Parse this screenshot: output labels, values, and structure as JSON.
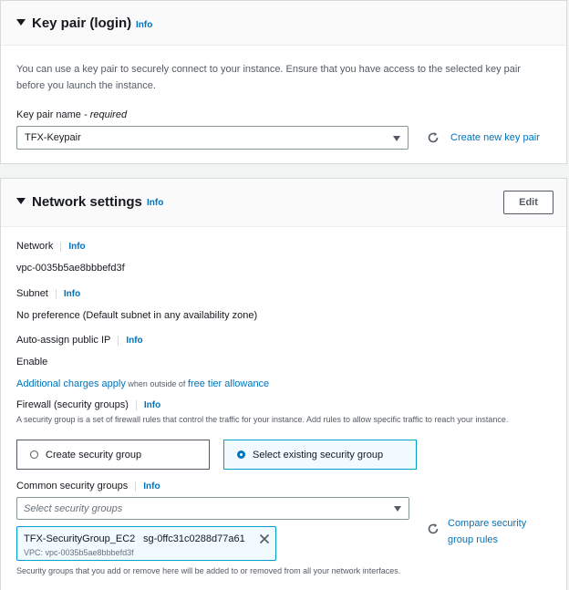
{
  "keypair": {
    "title": "Key pair (login)",
    "info": "Info",
    "description": "You can use a key pair to securely connect to your instance. Ensure that you have access to the selected key pair before you launch the instance.",
    "field_label": "Key pair name",
    "field_required": " - required",
    "selected_value": "TFX-Keypair",
    "create_link": "Create new key pair"
  },
  "network": {
    "title": "Network settings",
    "info": "Info",
    "edit_label": "Edit",
    "network_label": "Network",
    "network_value": "vpc-0035b5ae8bbbefd3f",
    "subnet_label": "Subnet",
    "subnet_value": "No preference (Default subnet in any availability zone)",
    "auto_ip_label": "Auto-assign public IP",
    "auto_ip_value": "Enable",
    "charges_link": "Additional charges apply",
    "charges_mid": " when outside of ",
    "free_tier_link": "free tier allowance",
    "firewall_label": "Firewall (security groups)",
    "firewall_desc": "A security group is a set of firewall rules that control the traffic for your instance. Add rules to allow specific traffic to reach your instance.",
    "radio_create": "Create security group",
    "radio_select": "Select existing security group",
    "common_sg_label": "Common security groups",
    "sg_placeholder": "Select security groups",
    "compare_link_1": "Compare security",
    "compare_link_2": "group rules",
    "token_name": "TFX-SecurityGroup_EC2",
    "token_id": "sg-0ffc31c0288d77a61",
    "token_vpc": "VPC: vpc-0035b5ae8bbbefd3f",
    "footer_note": "Security groups that you add or remove here will be added to or removed from all your network interfaces."
  },
  "colors": {
    "link": "#0073bb",
    "selected_border": "#00a1c9",
    "selected_bg": "#f1faff"
  }
}
